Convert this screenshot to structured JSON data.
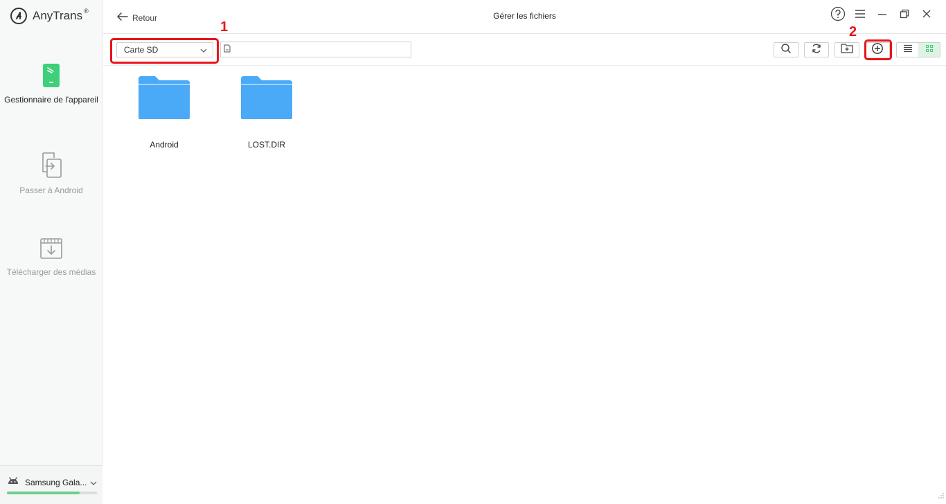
{
  "app": {
    "name": "AnyTrans",
    "reg_mark": "®"
  },
  "sidebar": {
    "items": [
      {
        "label": "Gestionnaire de l'appareil",
        "icon": "phone-manager-icon",
        "active": true
      },
      {
        "label": "Passer à Android",
        "icon": "switch-to-android-icon",
        "active": false
      },
      {
        "label": "Télécharger des médias",
        "icon": "download-media-icon",
        "active": false
      }
    ],
    "device": {
      "name": "Samsung Gala...",
      "icon": "android-icon",
      "storage_fraction": 0.81
    }
  },
  "header": {
    "back_label": "Retour",
    "title": "Gérer les fichiers",
    "icons": [
      "help-icon",
      "menu-icon",
      "minimize-icon",
      "restore-icon",
      "close-icon"
    ]
  },
  "toolbar": {
    "storage_selected": "Carte SD",
    "path_value": "",
    "buttons": [
      "search-icon",
      "refresh-icon",
      "new-folder-icon",
      "add-icon"
    ],
    "view_modes": [
      "list-view-icon",
      "grid-view-icon"
    ],
    "active_view": "grid"
  },
  "annotations": [
    {
      "number": "1",
      "target": "storage-select"
    },
    {
      "number": "2",
      "target": "add-button"
    }
  ],
  "files": [
    {
      "name": "Android",
      "type": "folder"
    },
    {
      "name": "LOST.DIR",
      "type": "folder"
    }
  ],
  "colors": {
    "accent_green": "#3ecf7a",
    "folder_blue": "#4aaaf7",
    "annotation_red": "#e8141b"
  }
}
